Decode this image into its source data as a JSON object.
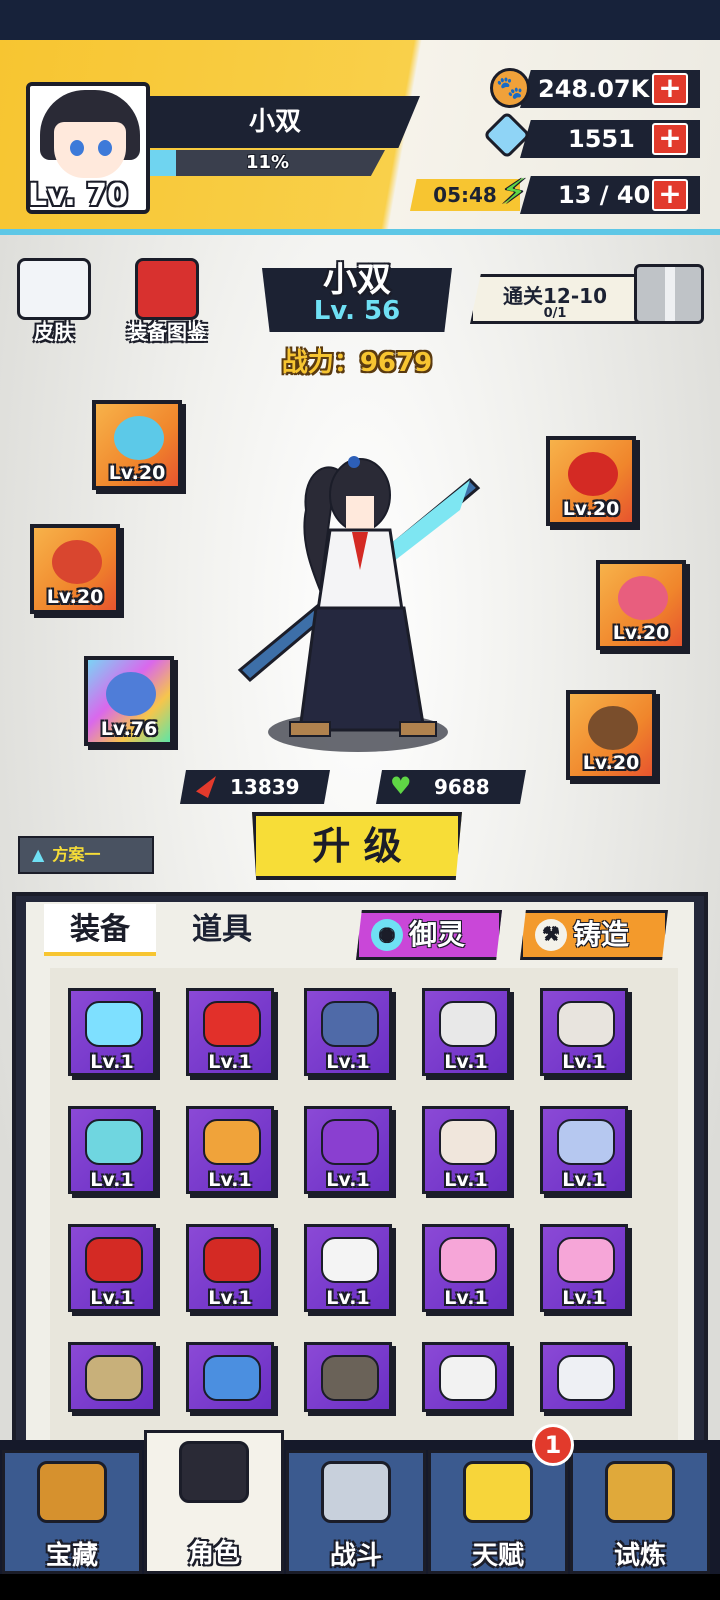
{
  "player": {
    "name": "小双",
    "level": "Lv. 70",
    "exp_text": "11%",
    "exp_fraction": 0.11
  },
  "resources": {
    "coins": "248.07K",
    "gems": "1551",
    "energy_timer": "05:48",
    "energy": "13 / 40",
    "plus_symbol": "+"
  },
  "side_menu": {
    "skin_label": "皮肤",
    "codex_label": "装备图鉴"
  },
  "hero": {
    "name": "小双",
    "level": "Lv. 56",
    "power": "战力：9679"
  },
  "stage_reward": {
    "title": "通关12-10",
    "progress": "0/1"
  },
  "equipped": [
    {
      "level": "Lv.20",
      "icon": "jade-pendant-icon",
      "color": "#5cc9e8"
    },
    {
      "level": "Lv.20",
      "icon": "ring-icon",
      "color": "#d9462f"
    },
    {
      "level": "Lv.76",
      "icon": "rainbow-blade-icon",
      "color": "#4f7dd8"
    },
    {
      "level": "Lv.20",
      "icon": "red-scarf-icon",
      "color": "#d42a24"
    },
    {
      "level": "Lv.20",
      "icon": "doll-costume-icon",
      "color": "#e85e7e"
    },
    {
      "level": "Lv.20",
      "icon": "boot-icon",
      "color": "#7a4e2c"
    }
  ],
  "stats": {
    "attack": "13839",
    "hp": "9688"
  },
  "upgrade_label": "升 级",
  "preset_label": "方案一",
  "tabs": {
    "equipment": "装备",
    "items": "道具"
  },
  "actions": {
    "spirit": "御灵",
    "forge": "铸造"
  },
  "inventory": [
    {
      "level": "Lv.1",
      "icon": "light-sword-icon",
      "color": "#7ee0ff"
    },
    {
      "level": "Lv.1",
      "icon": "red-sword-icon",
      "color": "#e2302a"
    },
    {
      "level": "Lv.1",
      "icon": "dark-blade-icon",
      "color": "#4f6aa8"
    },
    {
      "level": "Lv.1",
      "icon": "white-blade-icon",
      "color": "#e8e8e8"
    },
    {
      "level": "Lv.1",
      "icon": "red-ring-icon",
      "color": "#e8e4de"
    },
    {
      "level": "Lv.1",
      "icon": "jade-ring-icon",
      "color": "#6fd6e0"
    },
    {
      "level": "Lv.1",
      "icon": "dragon-ring-icon",
      "color": "#f0a33a"
    },
    {
      "level": "Lv.1",
      "icon": "purple-pendant-icon",
      "color": "#8a3fd0"
    },
    {
      "level": "Lv.1",
      "icon": "spiked-collar-icon",
      "color": "#f0e6dc"
    },
    {
      "level": "Lv.1",
      "icon": "ice-crown-icon",
      "color": "#b6c8f0"
    },
    {
      "level": "Lv.1",
      "icon": "red-scarf-icon",
      "color": "#d42a24"
    },
    {
      "level": "Lv.1",
      "icon": "red-scarf-icon",
      "color": "#d42a24"
    },
    {
      "level": "Lv.1",
      "icon": "oni-mask-icon",
      "color": "#f4f4f4"
    },
    {
      "level": "Lv.1",
      "icon": "pink-helmet-icon",
      "color": "#f6a6d8"
    },
    {
      "level": "Lv.1",
      "icon": "pink-helmet-icon",
      "color": "#f6a6d8"
    },
    {
      "level": "",
      "icon": "backpack-icon",
      "color": "#c8b07a"
    },
    {
      "level": "",
      "icon": "blue-glove-icon",
      "color": "#4b8fe0"
    },
    {
      "level": "",
      "icon": "vest-icon",
      "color": "#6a6258"
    },
    {
      "level": "",
      "icon": "karate-gi-icon",
      "color": "#f2f2f2"
    },
    {
      "level": "",
      "icon": "sailor-uniform-icon",
      "color": "#eef0f4"
    }
  ],
  "nav": [
    {
      "label": "宝藏",
      "icon": "treasure-chest-icon",
      "color": "#d6912e"
    },
    {
      "label": "角色",
      "icon": "character-portrait-icon",
      "color": "#2a2a36"
    },
    {
      "label": "战斗",
      "icon": "crossed-swords-icon",
      "color": "#c8d0dc"
    },
    {
      "label": "天赋",
      "icon": "lightbulb-icon",
      "color": "#f7d53a"
    },
    {
      "label": "试炼",
      "icon": "trial-emblem-icon",
      "color": "#e0a93a"
    }
  ],
  "nav_badge": "1",
  "colors": {
    "accent_yellow": "#f7c531",
    "dark_navy": "#1c2233",
    "cyan": "#6fe0f4",
    "red": "#e23a2c",
    "purple_cell": "#7b3dcf"
  }
}
